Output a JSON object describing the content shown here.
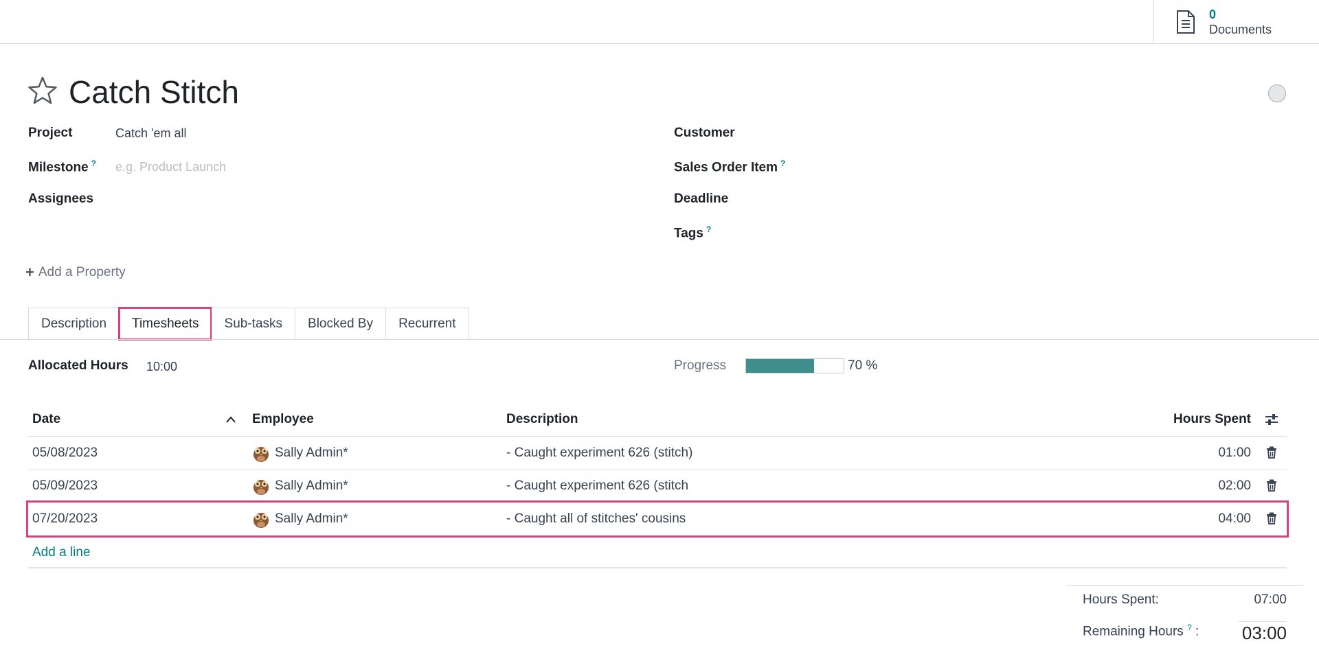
{
  "header": {
    "documents_count": "0",
    "documents_label": "Documents"
  },
  "task": {
    "title": "Catch Stitch"
  },
  "fields": {
    "project_label": "Project",
    "project_value": "Catch 'em all",
    "milestone_label": "Milestone",
    "milestone_help": "?",
    "milestone_placeholder": "e.g. Product Launch",
    "assignees_label": "Assignees",
    "customer_label": "Customer",
    "sales_order_item_label": "Sales Order Item",
    "sales_order_item_help": "?",
    "deadline_label": "Deadline",
    "tags_label": "Tags",
    "tags_help": "?"
  },
  "add_property": "Add a Property",
  "tabs": [
    {
      "label": "Description"
    },
    {
      "label": "Timesheets"
    },
    {
      "label": "Sub-tasks"
    },
    {
      "label": "Blocked By"
    },
    {
      "label": "Recurrent"
    }
  ],
  "timesheets": {
    "allocated_label": "Allocated Hours",
    "allocated_value": "10:00",
    "progress_label": "Progress",
    "progress_percent": 70,
    "progress_text": "70 %",
    "columns": {
      "date": "Date",
      "employee": "Employee",
      "description": "Description",
      "hours": "Hours Spent"
    },
    "rows": [
      {
        "date": "05/08/2023",
        "employee": "Sally Admin*",
        "description": "- Caught experiment 626 (stitch)",
        "hours": "01:00"
      },
      {
        "date": "05/09/2023",
        "employee": "Sally Admin*",
        "description": "- Caught experiment 626 (stitch",
        "hours": "02:00"
      },
      {
        "date": "07/20/2023",
        "employee": "Sally Admin*",
        "description": "- Caught all of stitches' cousins",
        "hours": "04:00"
      }
    ],
    "add_line": "Add a line",
    "totals": {
      "hours_spent_label": "Hours Spent:",
      "hours_spent_value": "07:00",
      "remaining_label": "Remaining Hours",
      "remaining_help": "?",
      "remaining_colon": ":",
      "remaining_value": "03:00"
    }
  },
  "colors": {
    "accent": "#017e84",
    "highlight": "#d0467a",
    "progress": "#3e8e8e"
  }
}
